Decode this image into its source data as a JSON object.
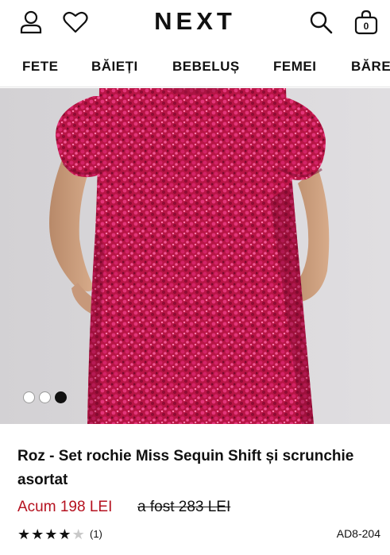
{
  "header": {
    "logo": "NEXT",
    "bag_count": "0",
    "icons": [
      "account-icon",
      "wishlist-heart-icon",
      "search-icon",
      "shopping-bag-icon"
    ]
  },
  "nav": {
    "items": [
      {
        "label": "FETE"
      },
      {
        "label": "BĂIEȚI"
      },
      {
        "label": "BEBELUȘ"
      },
      {
        "label": "FEMEI"
      },
      {
        "label": "BĂRE"
      }
    ]
  },
  "gallery": {
    "image": "pink sequin shift dress with puff sleeves",
    "dot_count": 3,
    "active_index": 2
  },
  "product": {
    "title": "Roz - Set rochie Miss Sequin Shift și scrunchie asortat",
    "price_now": "Acum 198 LEI",
    "price_was": "a fost 283 LEI",
    "rating": 4,
    "rating_max": 5,
    "review_count": "(1)",
    "sku": "AD8-204"
  },
  "colors": {
    "sale_red": "#b5111f",
    "dress_pink": "#c2184f",
    "text": "#111111"
  }
}
